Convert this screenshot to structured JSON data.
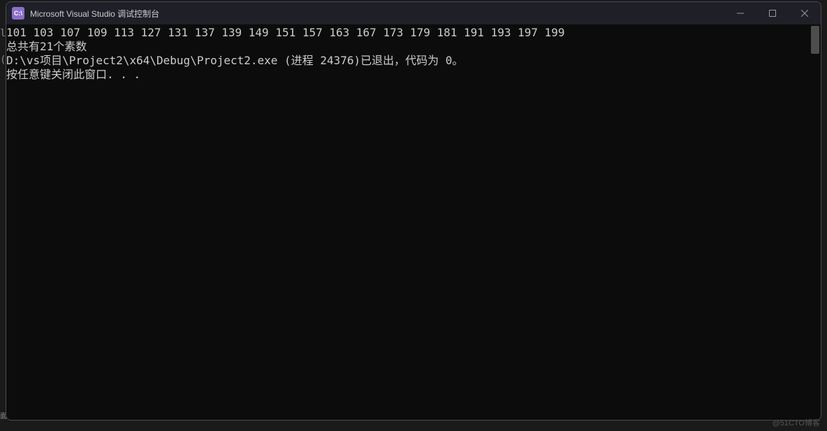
{
  "window": {
    "title": "Microsoft Visual Studio 调试控制台",
    "icon_text": "C:\\"
  },
  "console": {
    "lines": [
      "101 103 107 109 113 127 131 137 139 149 151 157 163 167 173 179 181 191 193 197 199",
      "总共有21个素数",
      "D:\\vs项目\\Project2\\x64\\Debug\\Project2.exe (进程 24376)已退出，代码为 0。",
      "按任意键关闭此窗口. . ."
    ]
  },
  "edge_fragments": {
    "f1": "l",
    "f2": "(",
    "f3": "面"
  },
  "watermark": "@51CTO博客"
}
